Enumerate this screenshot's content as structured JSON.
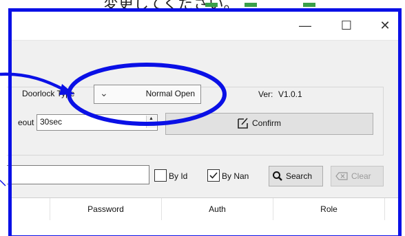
{
  "caption": {
    "text": "変更してください。"
  },
  "window": {
    "controls": {
      "minimize": "—",
      "maximize": "☐",
      "close": "✕"
    }
  },
  "settings": {
    "doorlock_type_label": "Doorlock Type",
    "doorlock_type_value": "Normal Open",
    "version_label": "Ver:",
    "version_value": "V1.0.1",
    "timeout_label": "eout",
    "timeout_value": "30sec",
    "confirm_label": "Confirm"
  },
  "search": {
    "input_value": "",
    "by_id_label": "By Id",
    "by_id_checked": false,
    "by_name_label": "By Nan",
    "by_name_checked": true,
    "search_label": "Search",
    "clear_label": "Clear"
  },
  "table": {
    "columns": [
      "",
      "Password",
      "Auth",
      "Role"
    ]
  },
  "annotation": {
    "color": "#0a10e6"
  }
}
